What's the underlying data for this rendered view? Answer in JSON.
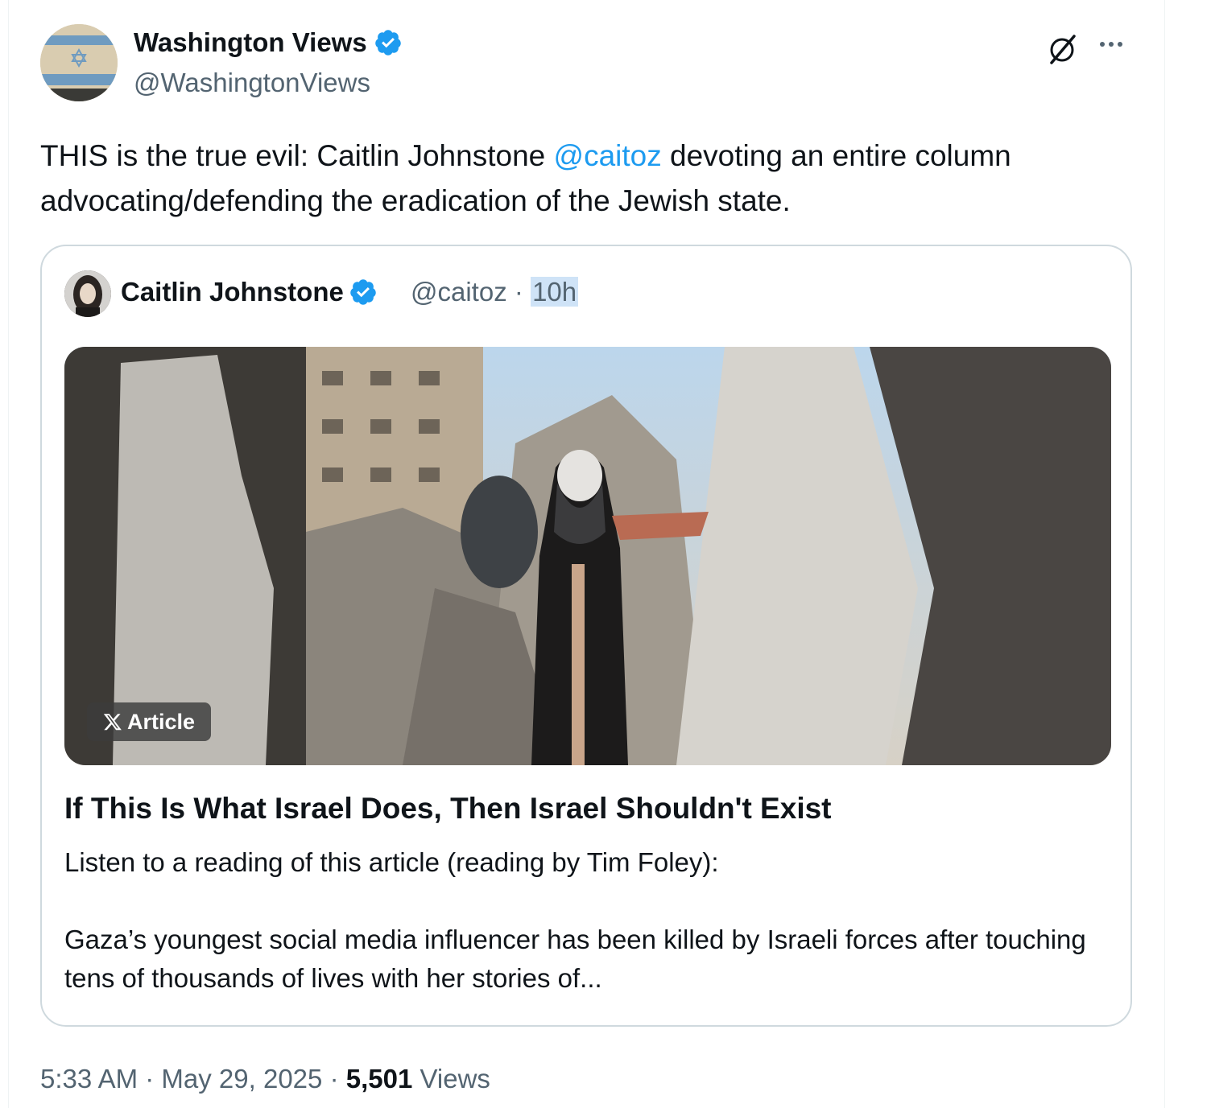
{
  "author": {
    "name": "Washington Views",
    "handle": "@WashingtonViews",
    "verified_icon": "verified-badge-icon"
  },
  "icons": {
    "grok": "grok-icon",
    "more": "more-options-icon",
    "x_logo": "x-logo-icon"
  },
  "tweet": {
    "text_before": "THIS is the true evil: Caitlin Johnstone ",
    "mention": "@caitoz",
    "text_after": " devoting an entire column advocating/defending the eradication of the Jewish state."
  },
  "quote": {
    "name": "Caitlin Johnstone",
    "handle": "@caitoz",
    "separator": "·",
    "time": "10h",
    "badge_label": "Article",
    "article_title": "If This Is What Israel Does, Then Israel Shouldn't Exist",
    "summary_line_1": "Listen to a reading of this article (reading by Tim Foley):",
    "summary_line_2": "Gaza’s youngest social media influencer has been killed by Israeli forces after touching tens of thousands of lives with her stories of..."
  },
  "footer": {
    "time": "5:33 AM",
    "separator": "·",
    "date": "May 29, 2025",
    "views_count": "5,501",
    "views_label": "Views"
  },
  "colors": {
    "accent": "#1d9bf0",
    "secondary_text": "#536471",
    "border": "#cfd9de"
  }
}
